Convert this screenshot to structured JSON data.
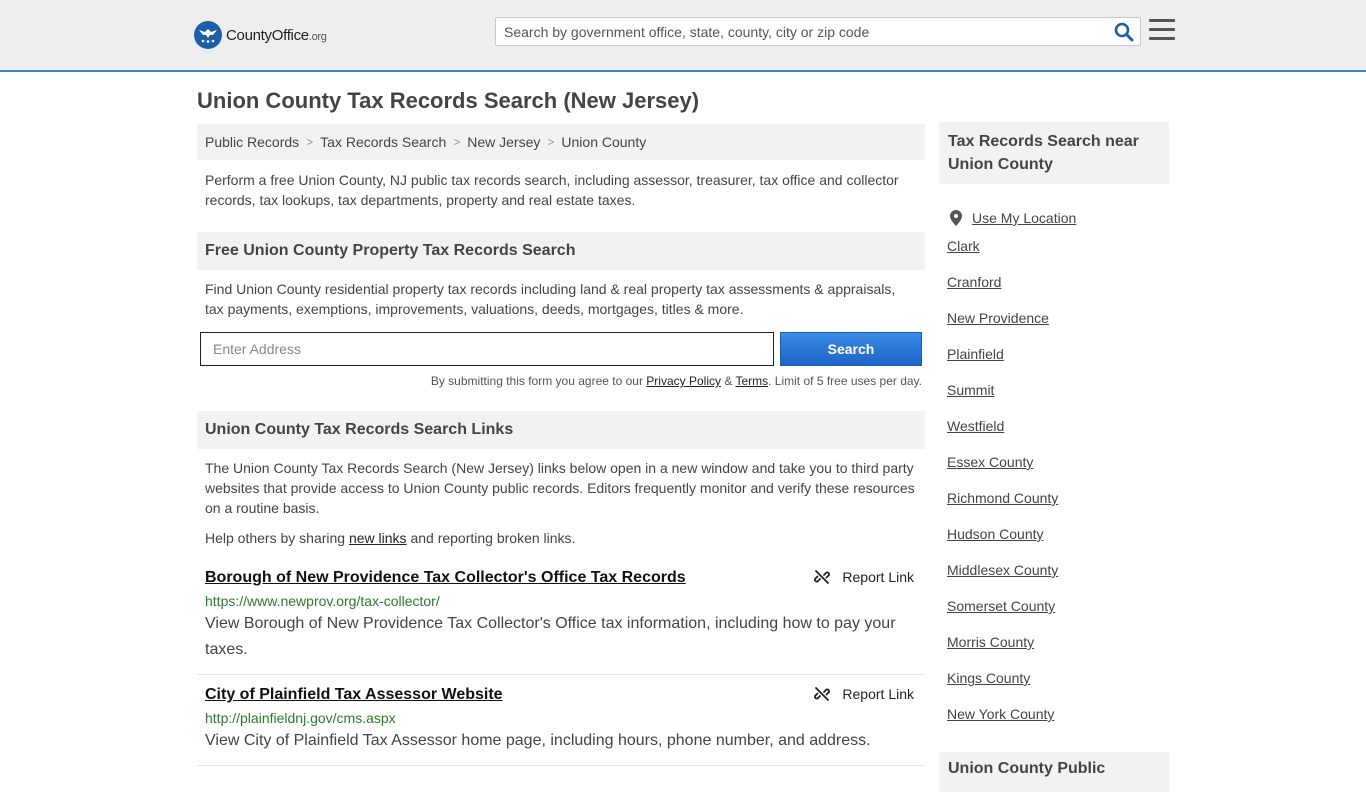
{
  "header": {
    "logo_main": "CountyOffice",
    "logo_suffix": ".org",
    "search_placeholder": "Search by government office, state, county, city or zip code"
  },
  "page": {
    "title": "Union County Tax Records Search (New Jersey)",
    "breadcrumb": [
      "Public Records",
      "Tax Records Search",
      "New Jersey",
      "Union County"
    ],
    "breadcrumb_separator": ">",
    "intro": "Perform a free Union County, NJ public tax records search, including assessor, treasurer, tax office and collector records, tax lookups, tax departments, property and real estate taxes."
  },
  "property_search": {
    "heading": "Free Union County Property Tax Records Search",
    "description": "Find Union County residential property tax records including land & real property tax assessments & appraisals, tax payments, exemptions, improvements, valuations, deeds, mortgages, titles & more.",
    "input_placeholder": "Enter Address",
    "button_label": "Search",
    "disclaimer_prefix": "By submitting this form you agree to our",
    "privacy_label": "Privacy Policy",
    "amp": "&",
    "terms_label": "Terms",
    "disclaimer_suffix": ". Limit of 5 free uses per day."
  },
  "links_section": {
    "heading": "Union County Tax Records Search Links",
    "description": "The Union County Tax Records Search (New Jersey) links below open in a new window and take you to third party websites that provide access to Union County public records. Editors frequently monitor and verify these resources on a routine basis.",
    "help_prefix": "Help others by sharing",
    "help_link": "new links",
    "help_suffix": "and reporting broken links.",
    "report_label": "Report Link",
    "results": [
      {
        "title": "Borough of New Providence Tax Collector's Office Tax Records",
        "url": "https://www.newprov.org/tax-collector/",
        "description": "View Borough of New Providence Tax Collector's Office tax information, including how to pay your taxes."
      },
      {
        "title": "City of Plainfield Tax Assessor Website",
        "url": "http://plainfieldnj.gov/cms.aspx",
        "description": "View City of Plainfield Tax Assessor home page, including hours, phone number, and address."
      }
    ]
  },
  "sidebar": {
    "heading": "Tax Records Search near Union County",
    "use_location": "Use My Location",
    "items": [
      "Clark",
      "Cranford",
      "New Providence",
      "Plainfield",
      "Summit",
      "Westfield",
      "Essex County",
      "Richmond County",
      "Hudson County",
      "Middlesex County",
      "Somerset County",
      "Morris County",
      "Kings County",
      "New York County"
    ],
    "next_heading": "Union County Public"
  },
  "colors": {
    "accent": "#3f83c6",
    "button": "#1c64c7",
    "url_green": "#2d7a2d"
  }
}
